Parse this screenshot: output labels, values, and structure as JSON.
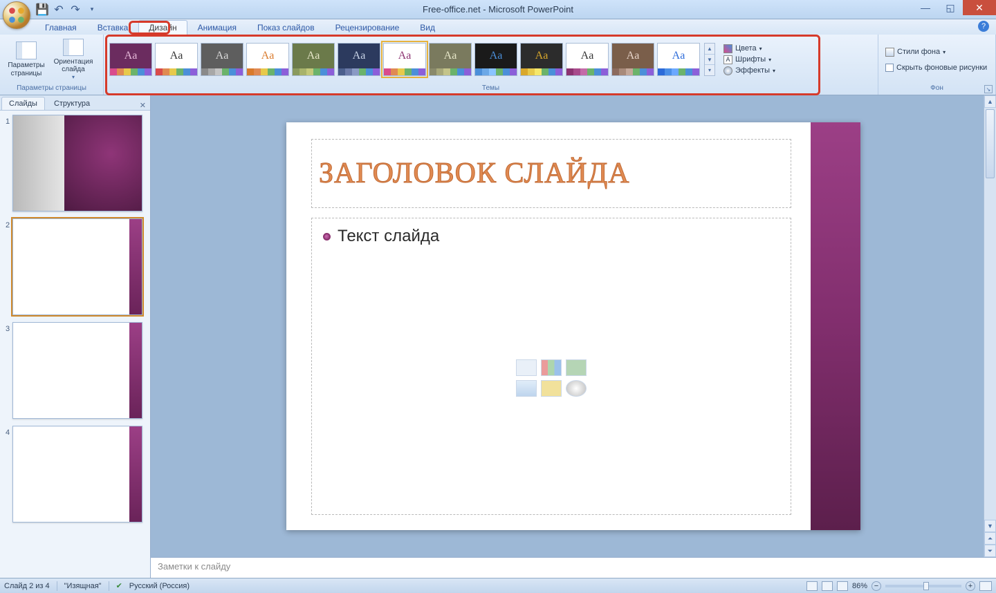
{
  "title": "Free-office.net - Microsoft PowerPoint",
  "tabs": [
    "Главная",
    "Вставка",
    "Дизайн",
    "Анимация",
    "Показ слайдов",
    "Рецензирование",
    "Вид"
  ],
  "active_tab_index": 2,
  "ribbon": {
    "page_setup_group": "Параметры страницы",
    "page_setup_btn": "Параметры\nстраницы",
    "orientation_btn": "Ориентация\nслайда",
    "themes_group": "Темы",
    "colors": "Цвета",
    "fonts": "Шрифты",
    "effects": "Эффекты",
    "bg_group": "Фон",
    "bg_styles": "Стили фона",
    "hide_bg": "Скрыть фоновые рисунки"
  },
  "themes": [
    {
      "bg": "#6b2c5f",
      "fg": "#e7bada",
      "bar": [
        "#d94b8c",
        "#e08a52",
        "#e7c94b",
        "#6bb36b",
        "#4b8fd9",
        "#8c5fd9"
      ]
    },
    {
      "bg": "#ffffff",
      "fg": "#333333",
      "bar": [
        "#d94b4b",
        "#e08a52",
        "#e7c94b",
        "#6bb36b",
        "#4b8fd9",
        "#8c5fd9"
      ]
    },
    {
      "bg": "#5e5e5e",
      "fg": "#d9d9d9",
      "bar": [
        "#8a8a8a",
        "#a8a8a8",
        "#c4c4c4",
        "#6bb36b",
        "#4b8fd9",
        "#8c5fd9"
      ]
    },
    {
      "bg": "#ffffff",
      "fg": "#d97a2c",
      "bar": [
        "#d97a2c",
        "#e08a52",
        "#e7c94b",
        "#6bb36b",
        "#4b8fd9",
        "#8c5fd9"
      ]
    },
    {
      "bg": "#6b7a4a",
      "fg": "#e7e7c9",
      "bar": [
        "#8a9a5e",
        "#a8b36b",
        "#c4c97a",
        "#6bb36b",
        "#4b8fd9",
        "#8c5fd9"
      ]
    },
    {
      "bg": "#2c3a5e",
      "fg": "#c9d4e7",
      "bar": [
        "#4b5f8c",
        "#6b7aa8",
        "#8a9ac4",
        "#6bb36b",
        "#4b8fd9",
        "#8c5fd9"
      ]
    },
    {
      "bg": "#ffffff",
      "fg": "#8c3371",
      "bar": [
        "#d94b8c",
        "#e08a52",
        "#e7c94b",
        "#6bb36b",
        "#4b8fd9",
        "#8c5fd9"
      ]
    },
    {
      "bg": "#7a7a5e",
      "fg": "#e7e7c9",
      "bar": [
        "#8a8a6b",
        "#a8a87a",
        "#c4c48a",
        "#6bb36b",
        "#4b8fd9",
        "#8c5fd9"
      ]
    },
    {
      "bg": "#1a1a1a",
      "fg": "#4b8fd9",
      "bar": [
        "#4b8fd9",
        "#6ba8e7",
        "#8ac4ff",
        "#6bb36b",
        "#4b8fd9",
        "#8c5fd9"
      ]
    },
    {
      "bg": "#2c2c2c",
      "fg": "#d9a82c",
      "bar": [
        "#d9a82c",
        "#e7c94b",
        "#f5e76b",
        "#6bb36b",
        "#4b8fd9",
        "#8c5fd9"
      ]
    },
    {
      "bg": "#ffffff",
      "fg": "#333333",
      "bar": [
        "#8c3371",
        "#a84b8c",
        "#c46ba8",
        "#6bb36b",
        "#4b8fd9",
        "#8c5fd9"
      ]
    },
    {
      "bg": "#7a5e4a",
      "fg": "#e7d4c9",
      "bar": [
        "#8c6b5e",
        "#a88a7a",
        "#c4a89a",
        "#6bb36b",
        "#4b8fd9",
        "#8c5fd9"
      ]
    },
    {
      "bg": "#ffffff",
      "fg": "#2c6bd9",
      "bar": [
        "#2c6bd9",
        "#4b8fe7",
        "#6ba8ff",
        "#6bb36b",
        "#4b8fd9",
        "#8c5fd9"
      ]
    }
  ],
  "selected_theme_index": 6,
  "side": {
    "slides_tab": "Слайды",
    "outline_tab": "Структура"
  },
  "slide_numbers": [
    "1",
    "2",
    "3",
    "4"
  ],
  "selected_slide": 1,
  "slide": {
    "title": "ЗАГОЛОВОК СЛАЙДА",
    "body": "Текст слайда"
  },
  "notes_placeholder": "Заметки к слайду",
  "status": {
    "slide_of": "Слайд 2 из 4",
    "theme_name": "\"Изящная\"",
    "lang": "Русский (Россия)",
    "zoom": "86%"
  }
}
